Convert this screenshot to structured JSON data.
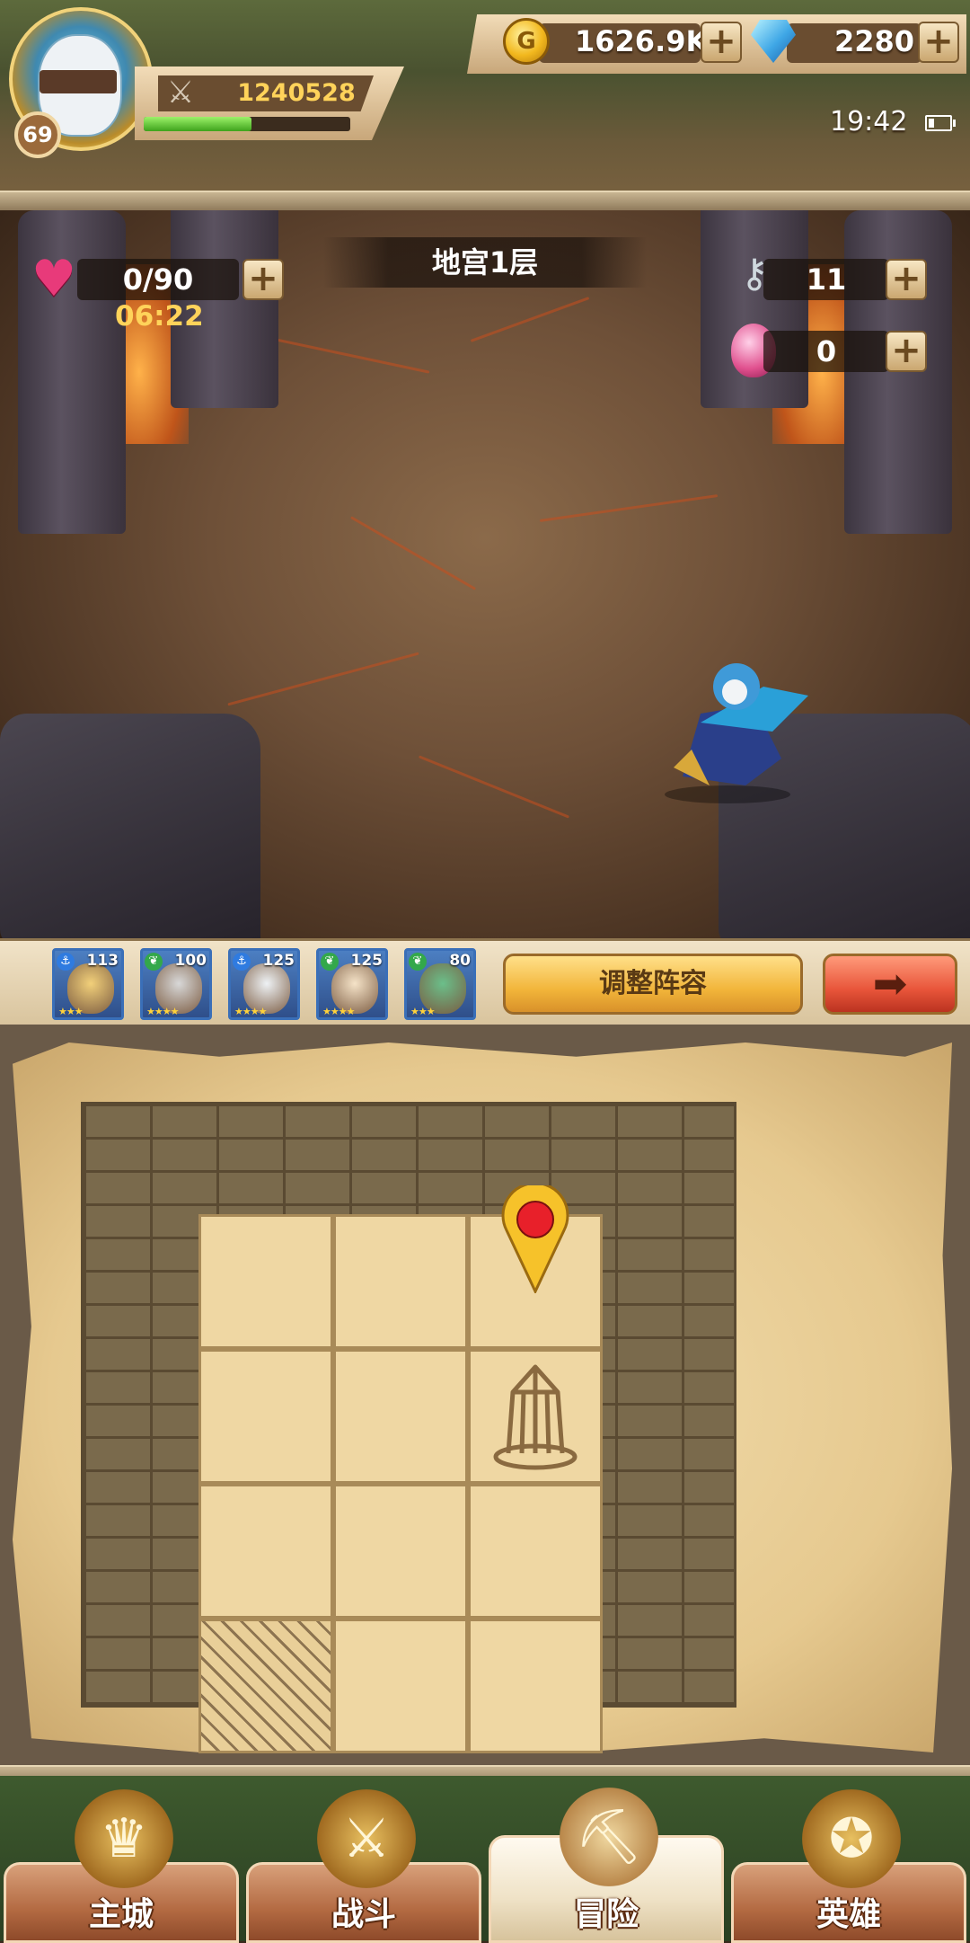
{
  "player": {
    "level": "69",
    "power": "1240528",
    "xp_fraction": 0.52
  },
  "resources": {
    "gold": "1626.9K",
    "diamonds": "2280",
    "plus": "+"
  },
  "status": {
    "time": "19:42"
  },
  "dungeon": {
    "floor_title": "地宫1层",
    "stamina": "0/90",
    "stamina_timer": "06:22",
    "keys": "11",
    "eggs": "0",
    "plus": "+"
  },
  "team": [
    {
      "level": "113",
      "class_icon": "anchor-icon",
      "stars": "★★★",
      "color": "#f2d07a"
    },
    {
      "level": "100",
      "class_icon": "leaf-icon",
      "stars": "★★★★",
      "color": "#d8d8d8"
    },
    {
      "level": "125",
      "class_icon": "anchor-icon",
      "stars": "★★★★",
      "color": "#eef2f5"
    },
    {
      "level": "125",
      "class_icon": "leaf-icon",
      "stars": "★★★★",
      "color": "#f5e3c8"
    },
    {
      "level": "80",
      "class_icon": "leaf-icon",
      "stars": "★★★",
      "color": "#6bbf8a"
    }
  ],
  "buttons": {
    "adjust_team": "调整阵容",
    "next_arrow": "➡"
  },
  "map": {
    "grid_cols": 3,
    "grid_rows": 4,
    "blocked_cells": [
      [
        3,
        0
      ]
    ],
    "player_pin": [
      0,
      2
    ],
    "tower": [
      1,
      2
    ]
  },
  "nav": {
    "tabs": [
      {
        "label": "主城",
        "icon": "castle-icon",
        "active": false
      },
      {
        "label": "战斗",
        "icon": "crossed-swords-icon",
        "active": false
      },
      {
        "label": "冒险",
        "icon": "map-scroll-icon",
        "active": true
      },
      {
        "label": "英雄",
        "icon": "hero-crest-icon",
        "active": false
      }
    ]
  },
  "colors": {
    "gold_text": "#ffd35a",
    "heart": "#e83a7a",
    "pin_red": "#e8202a",
    "pin_yellow": "#f6c22a"
  }
}
